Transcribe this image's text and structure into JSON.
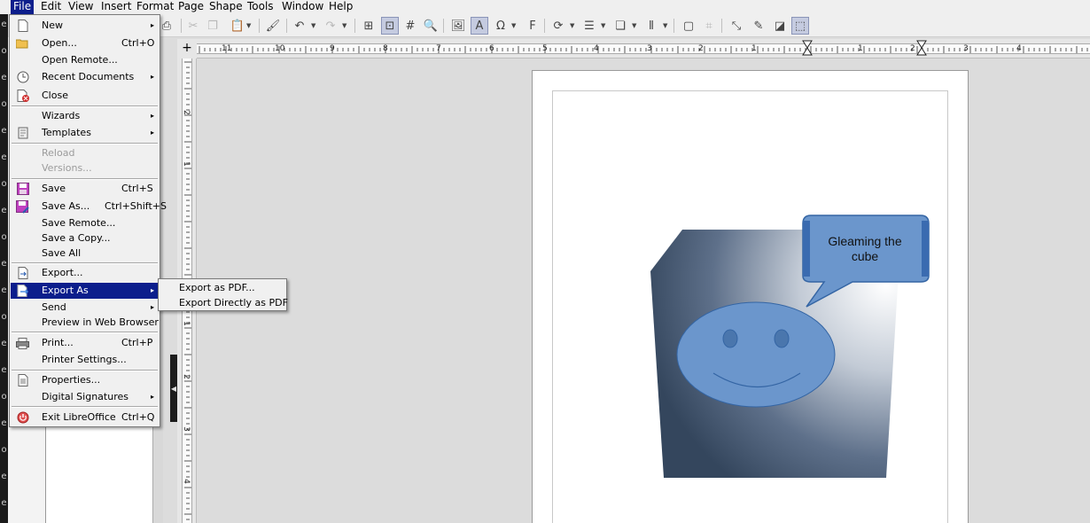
{
  "menubar": {
    "items": [
      "File",
      "Edit",
      "View",
      "Insert",
      "Format",
      "Page",
      "Shape",
      "Tools",
      "Window",
      "Help"
    ]
  },
  "file_menu": {
    "items": [
      {
        "label": "New",
        "shortcut": "",
        "submenu": true,
        "icon": "new-document-icon"
      },
      {
        "label": "Open...",
        "shortcut": "Ctrl+O",
        "submenu": false,
        "icon": "folder-open-icon"
      },
      {
        "label": "Open Remote...",
        "shortcut": "",
        "submenu": false,
        "icon": ""
      },
      {
        "label": "Recent Documents",
        "shortcut": "",
        "submenu": true,
        "icon": "clock-icon"
      },
      {
        "label": "Close",
        "shortcut": "",
        "submenu": false,
        "icon": "close-document-icon"
      },
      {
        "label": "Wizards",
        "shortcut": "",
        "submenu": true,
        "icon": ""
      },
      {
        "label": "Templates",
        "shortcut": "",
        "submenu": true,
        "icon": "template-icon"
      },
      {
        "label": "Reload",
        "shortcut": "",
        "submenu": false,
        "icon": "",
        "disabled": true
      },
      {
        "label": "Versions...",
        "shortcut": "",
        "submenu": false,
        "icon": "",
        "disabled": true
      },
      {
        "label": "Save",
        "shortcut": "Ctrl+S",
        "submenu": false,
        "icon": "save-icon"
      },
      {
        "label": "Save As...",
        "shortcut": "Ctrl+Shift+S",
        "submenu": false,
        "icon": "save-as-icon"
      },
      {
        "label": "Save Remote...",
        "shortcut": "",
        "submenu": false,
        "icon": ""
      },
      {
        "label": "Save a Copy...",
        "shortcut": "",
        "submenu": false,
        "icon": ""
      },
      {
        "label": "Save All",
        "shortcut": "",
        "submenu": false,
        "icon": ""
      },
      {
        "label": "Export...",
        "shortcut": "",
        "submenu": false,
        "icon": "export-icon"
      },
      {
        "label": "Export As",
        "shortcut": "",
        "submenu": true,
        "icon": "export-as-icon",
        "selected": true
      },
      {
        "label": "Send",
        "shortcut": "",
        "submenu": true,
        "icon": ""
      },
      {
        "label": "Preview in Web Browser",
        "shortcut": "",
        "submenu": false,
        "icon": ""
      },
      {
        "label": "Print...",
        "shortcut": "Ctrl+P",
        "submenu": false,
        "icon": "printer-icon"
      },
      {
        "label": "Printer Settings...",
        "shortcut": "",
        "submenu": false,
        "icon": ""
      },
      {
        "label": "Properties...",
        "shortcut": "",
        "submenu": false,
        "icon": "properties-icon"
      },
      {
        "label": "Digital Signatures",
        "shortcut": "",
        "submenu": true,
        "icon": ""
      },
      {
        "label": "Exit LibreOffice",
        "shortcut": "Ctrl+Q",
        "submenu": false,
        "icon": "power-icon"
      }
    ]
  },
  "export_submenu": {
    "items": [
      "Export as PDF...",
      "Export Directly as PDF"
    ]
  },
  "ruler": {
    "h_labels": [
      "11",
      "10",
      "9",
      "8",
      "7",
      "6",
      "5",
      "4",
      "3",
      "2",
      "1",
      "1",
      "2",
      "3",
      "4"
    ],
    "v_labels": [
      "2",
      "1",
      "1",
      "2",
      "3",
      "4",
      "5"
    ]
  },
  "drawing": {
    "callout_text": "Gleaming the cube",
    "cube_colors": {
      "dark": "#34465d",
      "light": "#ffffff"
    },
    "shape_fill": "#6b96cc",
    "shape_stroke": "#3465a4"
  },
  "colors": {
    "menu_highlight": "#0c1e8c"
  }
}
